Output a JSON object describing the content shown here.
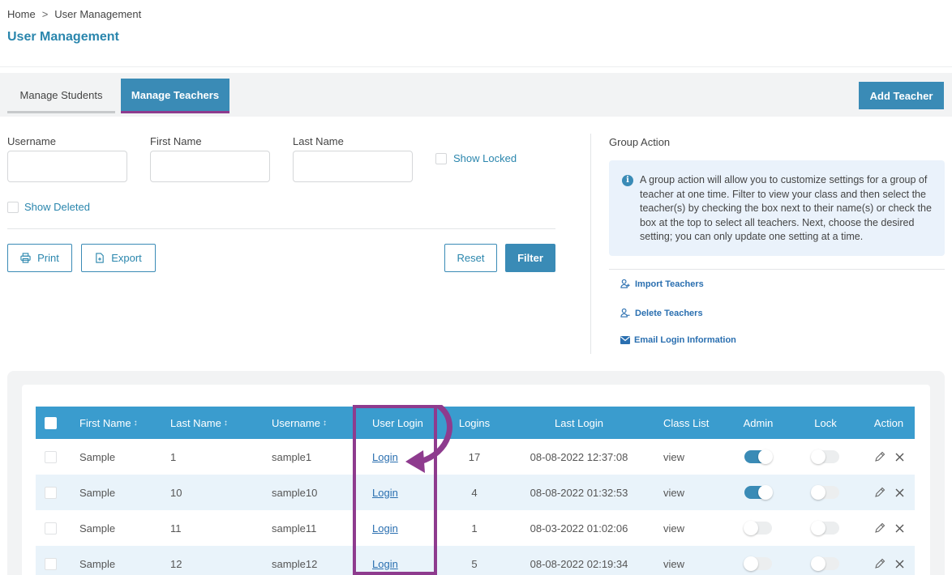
{
  "breadcrumb": {
    "home": "Home",
    "separator": ">",
    "current": "User Management"
  },
  "page_title": "User Management",
  "tabs": [
    {
      "label": "Manage Students"
    },
    {
      "label": "Manage Teachers"
    }
  ],
  "add_teacher_label": "Add Teacher",
  "filters": {
    "username_label": "Username",
    "first_name_label": "First Name",
    "last_name_label": "Last Name",
    "show_locked_label": "Show Locked",
    "show_deleted_label": "Show Deleted",
    "username_value": "",
    "first_name_value": "",
    "last_name_value": ""
  },
  "buttons": {
    "print": "Print",
    "export": "Export",
    "reset": "Reset",
    "filter": "Filter"
  },
  "group_action": {
    "title": "Group Action",
    "info": "A group action will allow you to customize settings for a group of teacher at one time. Filter to view your class and then select the teacher(s) by checking the box next to their name(s) or check the box at the top to select all teachers. Next, choose the desired setting; you can only update one setting at a time.",
    "links": [
      {
        "label": "Import Teachers",
        "icon": "user-plus-icon"
      },
      {
        "label": "Delete Teachers",
        "icon": "user-minus-icon"
      },
      {
        "label": "Email Login Information",
        "icon": "envelope-icon"
      }
    ]
  },
  "table": {
    "headers": {
      "first_name": "First Name",
      "last_name": "Last Name",
      "username": "Username",
      "user_login": "User Login",
      "logins": "Logins",
      "last_login": "Last Login",
      "class_list": "Class List",
      "admin": "Admin",
      "lock": "Lock",
      "action": "Action"
    },
    "sort_glyph": "↕",
    "rows": [
      {
        "first_name": "Sample",
        "last_name": "1",
        "username": "sample1",
        "user_login": "Login",
        "logins": "17",
        "last_login": "08-08-2022 12:37:08",
        "class_list": "view",
        "admin": true,
        "lock": false
      },
      {
        "first_name": "Sample",
        "last_name": "10",
        "username": "sample10",
        "user_login": "Login",
        "logins": "4",
        "last_login": "08-08-2022 01:32:53",
        "class_list": "view",
        "admin": true,
        "lock": false
      },
      {
        "first_name": "Sample",
        "last_name": "11",
        "username": "sample11",
        "user_login": "Login",
        "logins": "1",
        "last_login": "08-03-2022 01:02:06",
        "class_list": "view",
        "admin": false,
        "lock": false
      },
      {
        "first_name": "Sample",
        "last_name": "12",
        "username": "sample12",
        "user_login": "Login",
        "logins": "5",
        "last_login": "08-08-2022 02:19:34",
        "class_list": "view",
        "admin": false,
        "lock": false
      }
    ]
  },
  "colors": {
    "accent": "#3a8bb6",
    "header": "#3a9cce",
    "highlight": "#8e3b8e",
    "title": "#2a86ad"
  }
}
